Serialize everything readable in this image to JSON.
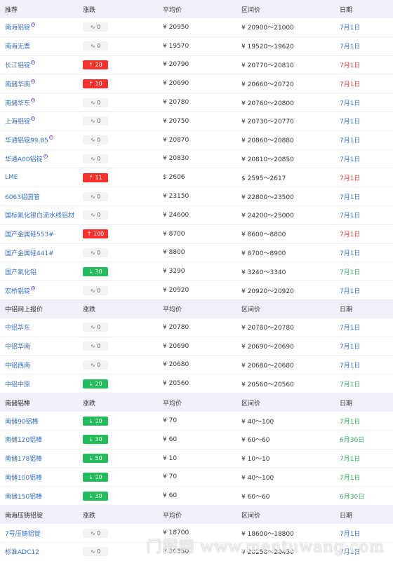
{
  "sections": [
    {
      "header": {
        "name": "推荐",
        "change": "涨跌",
        "avg": "平均价",
        "range": "区间价",
        "date": "日期"
      },
      "rows": [
        {
          "name": "南海铝锭",
          "reg": true,
          "change": "0",
          "trend": "neutral",
          "avg": "¥ 20950",
          "range": "¥ 20900～21000",
          "date": "7月1日",
          "date_color": "blue"
        },
        {
          "name": "南海无票",
          "reg": false,
          "change": "0",
          "trend": "neutral",
          "avg": "¥ 19570",
          "range": "¥ 19520～19620",
          "date": "7月1日",
          "date_color": "blue"
        },
        {
          "name": "长江铝锭",
          "reg": true,
          "change": "20",
          "trend": "up",
          "avg": "¥ 20790",
          "range": "¥ 20770～20810",
          "date": "7月1日",
          "date_color": "red"
        },
        {
          "name": "南储华南",
          "reg": true,
          "change": "10",
          "trend": "up",
          "avg": "¥ 20690",
          "range": "¥ 20660～20720",
          "date": "7月1日",
          "date_color": "red"
        },
        {
          "name": "南储华东",
          "reg": true,
          "change": "0",
          "trend": "neutral",
          "avg": "¥ 20780",
          "range": "¥ 20760～20800",
          "date": "7月1日",
          "date_color": "blue"
        },
        {
          "name": "上海铝锭",
          "reg": true,
          "change": "0",
          "trend": "neutral",
          "avg": "¥ 20750",
          "range": "¥ 20730～20770",
          "date": "7月1日",
          "date_color": "blue"
        },
        {
          "name": "华通铝锭99.85",
          "reg": true,
          "change": "0",
          "trend": "neutral",
          "avg": "¥ 20870",
          "range": "¥ 20860～20880",
          "date": "7月1日",
          "date_color": "blue"
        },
        {
          "name": "华通A00铝锭",
          "reg": true,
          "change": "0",
          "trend": "neutral",
          "avg": "¥ 20830",
          "range": "¥ 20810～20850",
          "date": "7月1日",
          "date_color": "blue"
        },
        {
          "name": "LME",
          "reg": false,
          "change": "11",
          "trend": "up",
          "avg": "$ 2606",
          "range": "$ 2595～2617",
          "date": "7月1日",
          "date_color": "red"
        },
        {
          "name": "6063铝圆管",
          "reg": false,
          "change": "0",
          "trend": "neutral",
          "avg": "¥ 23150",
          "range": "¥ 22800～23500",
          "date": "7月1日",
          "date_color": "blue"
        },
        {
          "name": "国标氧化银白流水线铝材",
          "reg": false,
          "change": "0",
          "trend": "neutral",
          "avg": "¥ 24600",
          "range": "¥ 24200～25000",
          "date": "7月1日",
          "date_color": "blue"
        },
        {
          "name": "国产金属硅553#",
          "reg": false,
          "change": "100",
          "trend": "up",
          "avg": "¥ 8700",
          "range": "¥ 8600～8800",
          "date": "7月1日",
          "date_color": "red"
        },
        {
          "name": "国产金属硅441#",
          "reg": false,
          "change": "0",
          "trend": "neutral",
          "avg": "¥ 8800",
          "range": "¥ 8700～8900",
          "date": "7月1日",
          "date_color": "blue"
        },
        {
          "name": "国产氧化铝",
          "reg": false,
          "change": "30",
          "trend": "down",
          "avg": "¥ 3290",
          "range": "¥ 3240～3340",
          "date": "7月1日",
          "date_color": "green"
        },
        {
          "name": "宏桥铝锭",
          "reg": true,
          "change": "0",
          "trend": "neutral",
          "avg": "¥ 20920",
          "range": "¥ 20920～20920",
          "date": "7月1日",
          "date_color": "blue"
        }
      ]
    },
    {
      "header": {
        "name": "中铝网上报价",
        "change": "涨跌",
        "avg": "平均价",
        "range": "区间价",
        "date": "日期"
      },
      "rows": [
        {
          "name": "中铝华东",
          "reg": false,
          "change": "0",
          "trend": "neutral",
          "avg": "¥ 20780",
          "range": "¥ 20780～20780",
          "date": "7月1日",
          "date_color": "blue"
        },
        {
          "name": "中铝华南",
          "reg": false,
          "change": "0",
          "trend": "neutral",
          "avg": "¥ 20690",
          "range": "¥ 20690～20690",
          "date": "7月1日",
          "date_color": "blue"
        },
        {
          "name": "中铝西南",
          "reg": false,
          "change": "0",
          "trend": "neutral",
          "avg": "¥ 20680",
          "range": "¥ 20680～20680",
          "date": "7月1日",
          "date_color": "blue"
        },
        {
          "name": "中铝中原",
          "reg": false,
          "change": "20",
          "trend": "down",
          "avg": "¥ 20560",
          "range": "¥ 20560～20560",
          "date": "7月1日",
          "date_color": "green"
        }
      ]
    },
    {
      "header": {
        "name": "南储铝棒",
        "change": "涨跌",
        "avg": "平均价",
        "range": "区间价",
        "date": "日期"
      },
      "rows": [
        {
          "name": "南储90铝棒",
          "reg": false,
          "change": "10",
          "trend": "down",
          "avg": "¥ 70",
          "range": "¥ 40～100",
          "date": "7月1日",
          "date_color": "green"
        },
        {
          "name": "南储120铝棒",
          "reg": false,
          "change": "30",
          "trend": "down",
          "avg": "¥ 60",
          "range": "¥ 60～60",
          "date": "6月30日",
          "date_color": "green"
        },
        {
          "name": "南储178铝棒",
          "reg": false,
          "change": "50",
          "trend": "down",
          "avg": "¥ 10",
          "range": "¥ 10～10",
          "date": "7月1日",
          "date_color": "green"
        },
        {
          "name": "南储100铝棒",
          "reg": false,
          "change": "10",
          "trend": "down",
          "avg": "¥ 70",
          "range": "¥ 40～100",
          "date": "7月1日",
          "date_color": "green"
        },
        {
          "name": "南储150铝棒",
          "reg": false,
          "change": "30",
          "trend": "down",
          "avg": "¥ 60",
          "range": "¥ 60～60",
          "date": "6月30日",
          "date_color": "green"
        }
      ]
    },
    {
      "header": {
        "name": "南海压铸铝锭",
        "change": "涨跌",
        "avg": "平均价",
        "range": "区间价",
        "date": "日期"
      },
      "rows": [
        {
          "name": "7号压铸铝锭",
          "reg": false,
          "change": "0",
          "trend": "neutral",
          "avg": "¥ 18700",
          "range": "¥ 18600～18800",
          "date": "7月1日",
          "date_color": "blue"
        },
        {
          "name": "标准ADC12",
          "reg": false,
          "change": "0",
          "trend": "neutral",
          "avg": "¥ 20350",
          "range": "¥ 20250～20450",
          "date": "7月1日",
          "date_color": "blue"
        }
      ]
    }
  ],
  "watermark": "门图网 www.mentuwang.com"
}
